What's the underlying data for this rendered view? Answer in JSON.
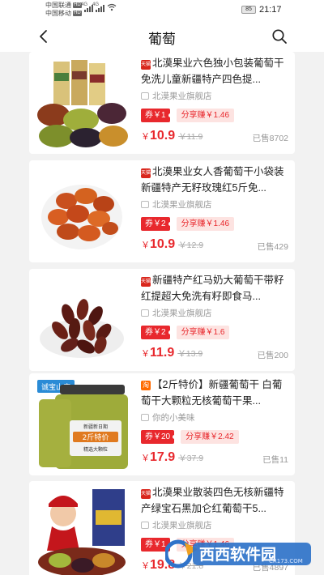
{
  "status_bar": {
    "carrier1": "中国联通",
    "carrier2": "中国移动",
    "hd": "HD",
    "net1": "4G",
    "net2": "4G",
    "battery": "85",
    "time": "21:17"
  },
  "header": {
    "title": "葡萄"
  },
  "products": [
    {
      "platform": "天猫",
      "title": "北漠果业六色独小包装葡萄干免洗儿童新疆特产四色提...",
      "shop": "北漠果业旗舰店",
      "coupon": "券￥1",
      "share": "分享赚￥1.46",
      "price_symbol": "￥",
      "price": "10.9",
      "original_price": "￥11.9",
      "sold": "已售8702"
    },
    {
      "platform": "天猫",
      "title": "北漠果业女人香葡萄干小袋装新疆特产无籽玫瑰红5斤免...",
      "shop": "北漠果业旗舰店",
      "coupon": "券￥2",
      "share": "分享赚￥1.46",
      "price_symbol": "￥",
      "price": "10.9",
      "original_price": "￥12.9",
      "sold": "已售429"
    },
    {
      "platform": "天猫",
      "title": "新疆特产红马奶大葡萄干带籽红提超大免洗有籽即食马...",
      "shop": "北漠果业旗舰店",
      "coupon": "券￥2",
      "share": "分享赚￥1.6",
      "price_symbol": "￥",
      "price": "11.9",
      "original_price": "￥13.9",
      "sold": "已售200"
    },
    {
      "platform": "淘",
      "title": "【2斤特价】新疆葡萄干 白葡萄干大颗粒无核葡萄干果...",
      "shop": "你的小美味",
      "coupon": "券￥20",
      "share": "分享赚￥2.42",
      "price_symbol": "￥",
      "price": "17.9",
      "original_price": "￥37.9",
      "sold": "已售11",
      "image_text": [
        "诚宝山庄",
        "新疆新日期",
        "2斤特价",
        "精选大颗粒"
      ]
    },
    {
      "platform": "天猫",
      "title": "北漠果业散装四色无核新疆特产绿宝石黑加仑红葡萄干5...",
      "shop": "北漠果业旗舰店",
      "coupon": "券￥1",
      "share": "分享赚￥1.46",
      "price_symbol": "￥",
      "price": "19.8",
      "original_price": "￥21.8",
      "sold": "已售4897"
    }
  ],
  "watermark": {
    "brand": "西西软件园",
    "url": "CR173.COM"
  },
  "colors": {
    "accent": "#e8282d",
    "share_bg": "#fde3e1",
    "tmall": "#d9261c",
    "taobao": "#ff6a00"
  }
}
